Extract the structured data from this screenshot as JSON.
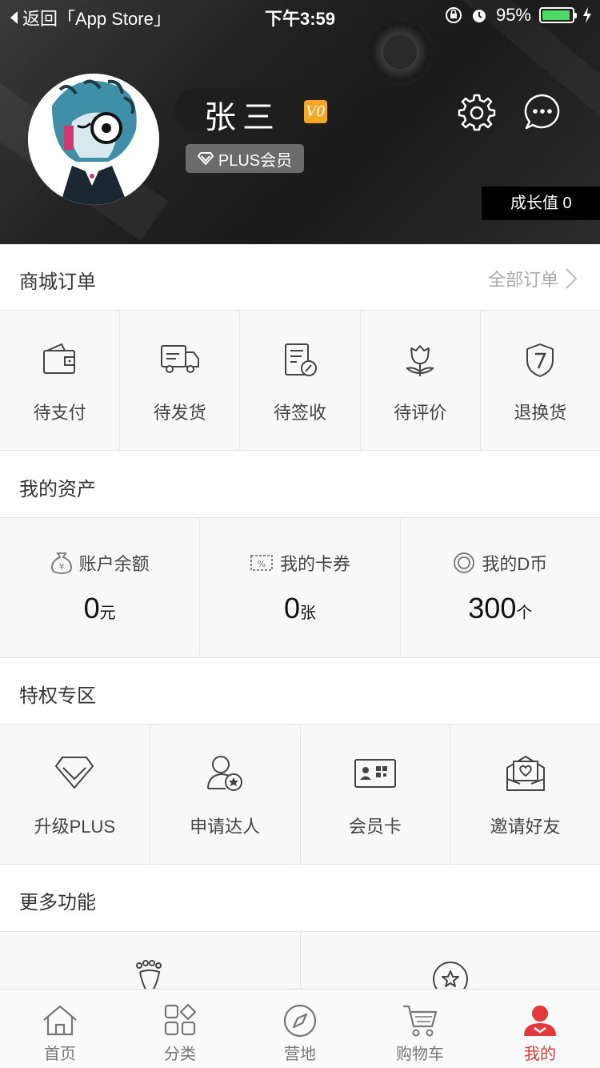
{
  "status_bar": {
    "back_label": "返回「App Store」",
    "time": "下午3:59",
    "battery": "95%",
    "battery_level": 0.95
  },
  "profile": {
    "name": "张三",
    "level": "V0",
    "member_badge": "PLUS会员",
    "growth": "成长值 0"
  },
  "orders": {
    "title": "商城订单",
    "all_label": "全部订单",
    "items": [
      {
        "label": "待支付",
        "icon": "wallet-icon"
      },
      {
        "label": "待发货",
        "icon": "truck-icon"
      },
      {
        "label": "待签收",
        "icon": "sign-doc-icon"
      },
      {
        "label": "待评价",
        "icon": "flower-icon"
      },
      {
        "label": "退换货",
        "icon": "shield-return-icon"
      }
    ]
  },
  "assets": {
    "title": "我的资产",
    "items": [
      {
        "label": "账户余额",
        "value": "0",
        "unit": "元",
        "icon": "money-bag-icon"
      },
      {
        "label": "我的卡券",
        "value": "0",
        "unit": "张",
        "icon": "coupon-icon"
      },
      {
        "label": "我的D币",
        "value": "300",
        "unit": "个",
        "icon": "coin-icon"
      }
    ]
  },
  "privileges": {
    "title": "特权专区",
    "items": [
      {
        "label": "升级PLUS",
        "icon": "diamond-icon"
      },
      {
        "label": "申请达人",
        "icon": "user-star-icon"
      },
      {
        "label": "会员卡",
        "icon": "member-card-icon"
      },
      {
        "label": "邀请好友",
        "icon": "invite-envelope-icon"
      }
    ]
  },
  "more": {
    "title": "更多功能",
    "items": [
      {
        "icon": "footprint-icon"
      },
      {
        "icon": "star-circle-icon"
      }
    ]
  },
  "tabbar": [
    {
      "label": "首页",
      "icon": "home-icon"
    },
    {
      "label": "分类",
      "icon": "category-icon"
    },
    {
      "label": "营地",
      "icon": "compass-icon"
    },
    {
      "label": "购物车",
      "icon": "cart-icon"
    },
    {
      "label": "我的",
      "icon": "user-icon",
      "active": true
    }
  ],
  "colors": {
    "accent": "#e4393c",
    "header_bg": "#222222",
    "vip_badge": "#f5a623",
    "battery": "#4cd964"
  }
}
